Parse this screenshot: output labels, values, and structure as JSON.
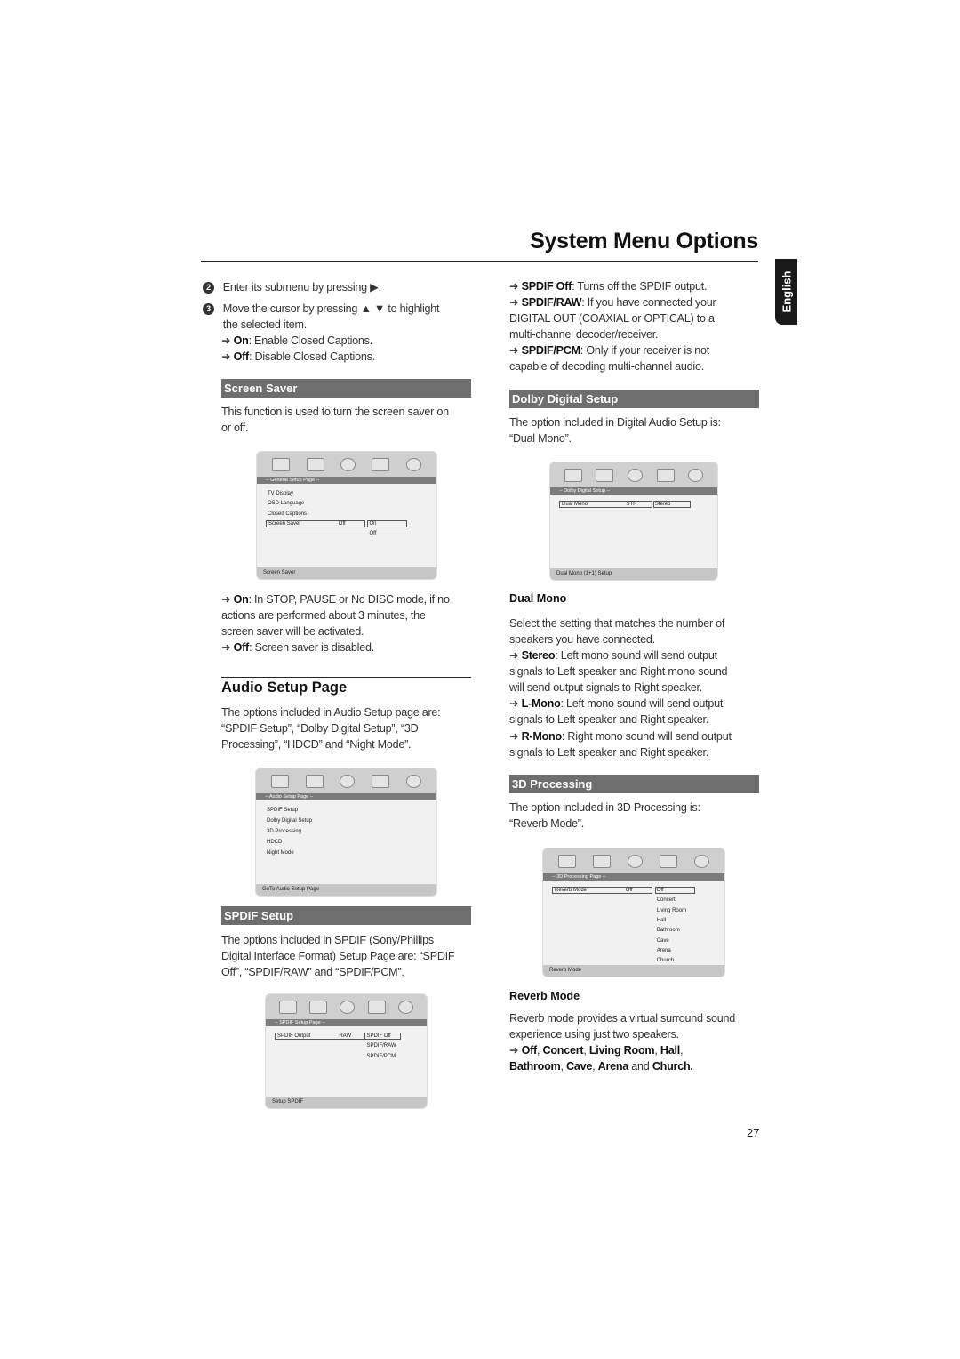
{
  "header": {
    "title": "System Menu Options",
    "language_tab": "English"
  },
  "left": {
    "step2": {
      "num": "2",
      "text": [
        {
          "t": "Enter its submenu by pressing ▶."
        }
      ]
    },
    "step3": {
      "num": "3",
      "text": [
        {
          "t": "Move the cursor by pressing ▲ ▼  to highlight\nthe selected item."
        }
      ]
    },
    "cc_on": [
      {
        "t": "➜ "
      },
      {
        "t": "On",
        "b": true
      },
      {
        "t": ": Enable Closed Captions."
      }
    ],
    "cc_off": [
      {
        "t": "➜ "
      },
      {
        "t": "Off",
        "b": true
      },
      {
        "t": ": Disable Closed Captions."
      }
    ],
    "screen_saver_bar": "Screen Saver",
    "screen_saver_desc": [
      {
        "t": "This function is used to turn the screen saver on\nor off."
      }
    ],
    "ss_on": [
      {
        "t": "➜ "
      },
      {
        "t": "On",
        "b": true
      },
      {
        "t": ": In STOP, PAUSE or No DISC mode, if no\nactions are performed about 3 minutes, the\nscreen saver will be activated."
      }
    ],
    "ss_off": [
      {
        "t": "➜ "
      },
      {
        "t": "Off",
        "b": true
      },
      {
        "t": ": Screen saver is disabled."
      }
    ],
    "audio_heading": "Audio Setup Page",
    "audio_desc": [
      {
        "t": "The options included in Audio Setup page are:\n“SPDIF Setup”, “Dolby Digital Setup”, “3D\nProcessing”, “HDCD” and “Night Mode”."
      }
    ],
    "spdif_bar": "SPDIF Setup",
    "spdif_desc": [
      {
        "t": "The options included in SPDIF (Sony/Phillips\nDigital Interface Format) Setup Page are: “SPDIF\nOff”, “SPDIF/RAW” and “SPDIF/PCM”."
      }
    ]
  },
  "right": {
    "spdif_off": [
      {
        "t": "➜ "
      },
      {
        "t": "SPDIF Off",
        "b": true
      },
      {
        "t": ": Turns off the SPDIF output."
      }
    ],
    "spdif_raw": [
      {
        "t": "➜ "
      },
      {
        "t": "SPDIF/RAW",
        "b": true
      },
      {
        "t": ": If you have connected your\nDIGITAL OUT (COAXIAL or OPTICAL) to a\nmulti-channel decoder/receiver."
      }
    ],
    "spdif_pcm": [
      {
        "t": "➜ "
      },
      {
        "t": "SPDIF/PCM",
        "b": true
      },
      {
        "t": ": Only if your receiver is not\ncapable of decoding multi-channel audio."
      }
    ],
    "dolby_bar": "Dolby Digital Setup",
    "dolby_desc": [
      {
        "t": "The option included in Digital Audio Setup is:\n“Dual Mono”."
      }
    ],
    "dual_mono_heading": "Dual Mono",
    "dual_mono_desc": [
      {
        "t": "Select the setting that matches the number of\nspeakers you have connected."
      }
    ],
    "stereo": [
      {
        "t": "➜ "
      },
      {
        "t": "Stereo",
        "b": true
      },
      {
        "t": ": Left mono sound will send output\nsignals to Left speaker and Right mono sound\nwill send output signals to Right speaker."
      }
    ],
    "lmono": [
      {
        "t": "➜ "
      },
      {
        "t": "L-Mono",
        "b": true
      },
      {
        "t": ": Left mono sound will send output\nsignals to Left speaker and Right speaker."
      }
    ],
    "rmono": [
      {
        "t": "➜ "
      },
      {
        "t": "R-Mono",
        "b": true
      },
      {
        "t": ": Right mono sound will send output\nsignals to Left speaker and Right speaker."
      }
    ],
    "proc_bar": "3D Processing",
    "proc_desc": [
      {
        "t": "The option included in 3D Processing is:\n“Reverb Mode”."
      }
    ],
    "reverb_heading": "Reverb Mode",
    "reverb_desc": [
      {
        "t": "Reverb mode provides a virtual surround sound\nexperience using just two speakers."
      }
    ],
    "reverb_opts": [
      {
        "t": "➜ "
      },
      {
        "t": "Off",
        "b": true
      },
      {
        "t": ", "
      },
      {
        "t": "Concert",
        "b": true
      },
      {
        "t": ", "
      },
      {
        "t": "Living Room",
        "b": true
      },
      {
        "t": ", "
      },
      {
        "t": "Hall",
        "b": true
      },
      {
        "t": ",\n"
      },
      {
        "t": "Bathroom",
        "b": true
      },
      {
        "t": ", "
      },
      {
        "t": "Cave",
        "b": true
      },
      {
        "t": ", "
      },
      {
        "t": "Arena",
        "b": true
      },
      {
        "t": " and "
      },
      {
        "t": "Church.",
        "b": true
      }
    ]
  },
  "menus": {
    "general": {
      "title": "-- General Setup Page --",
      "items": [
        "TV Display",
        "OSD Language",
        "Closed Captions"
      ],
      "row": {
        "label": "Screen Saver",
        "value": "Off"
      },
      "options": [
        "On",
        "Off"
      ],
      "footer": "Screen Saver"
    },
    "audio": {
      "title": "-- Audio Setup Page --",
      "items": [
        "SPDIF Setup",
        "Dolby Digital Setup",
        "3D Processing",
        "HDCD",
        "Night Mode"
      ],
      "footer": "GoTo Audio Setup Page"
    },
    "spdif": {
      "title": "-- SPDIF Setup Page --",
      "items": [],
      "row": {
        "label": "SPDIF Output",
        "value": "RAW"
      },
      "options": [
        "SPDIF Off",
        "SPDIF/RAW",
        "SPDIF/PCM"
      ],
      "footer": "Setup SPDIF"
    },
    "dolby": {
      "title": "-- Dolby Digital Setup --",
      "items": [],
      "row": {
        "label": "Dual Mono",
        "value": "STR"
      },
      "options": [
        "Stereo"
      ],
      "footer": "Dual Mono (1+1) Setup"
    },
    "proc3d": {
      "title": "-- 3D Processing Page --",
      "items": [],
      "row": {
        "label": "Reverb Mode",
        "value": "Off"
      },
      "options": [
        "Off",
        "Concert",
        "Living Room",
        "Hall",
        "Bathroom",
        "Cave",
        "Arena",
        "Church"
      ],
      "footer": "Reverb Mode"
    }
  },
  "menu_icons": [
    "general-setup-icon",
    "audio-setup-icon",
    "dolby-digital-icon",
    "preference-icon",
    "password-lock-icon"
  ],
  "page_number": "27"
}
